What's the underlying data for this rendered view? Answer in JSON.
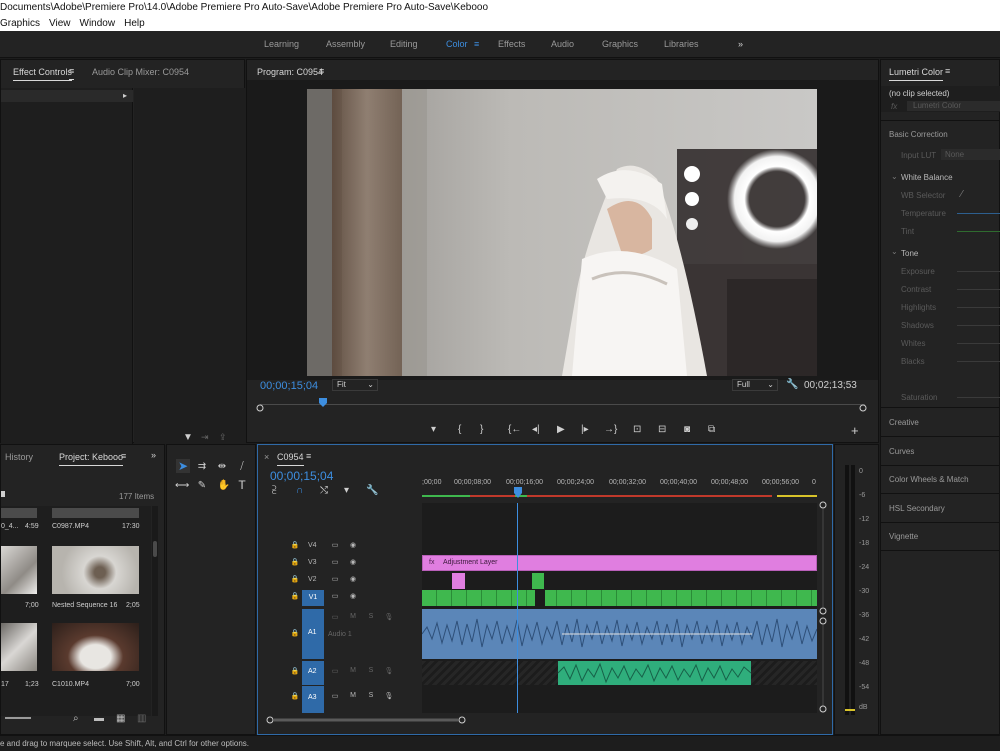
{
  "window": {
    "title": "Documents\\Adobe\\Premiere Pro\\14.0\\Adobe Premiere Pro Auto-Save\\Adobe Premiere Pro Auto-Save\\Kebooo"
  },
  "menu": [
    "Graphics",
    "View",
    "Window",
    "Help"
  ],
  "workspaces": [
    "Learning",
    "Assembly",
    "Editing",
    "Color",
    "Effects",
    "Audio",
    "Graphics",
    "Libraries"
  ],
  "workspace_active": "Color",
  "workspace_more": "»",
  "effect_panel": {
    "tab_effect_controls": "Effect Controls",
    "tab_audio_mixer": "Audio Clip Mixer: C0954"
  },
  "program": {
    "title": "Program: C0954",
    "timecode": "00;00;15;04",
    "fit": "Fit",
    "quality": "Full",
    "duration": "00;02;13;53"
  },
  "lumetri": {
    "title": "Lumetri Color",
    "clip": "(no clip selected)",
    "fx_label": "fx",
    "fx_name": "Lumetri Color",
    "basic_correction": "Basic Correction",
    "input_lut": "Input LUT",
    "lut_value": "None",
    "white_balance": "White Balance",
    "wb_selector": "WB Selector",
    "temperature": "Temperature",
    "tint": "Tint",
    "tone": "Tone",
    "exposure": "Exposure",
    "contrast": "Contrast",
    "highlights": "Highlights",
    "shadows": "Shadows",
    "whites": "Whites",
    "blacks": "Blacks",
    "saturation": "Saturation",
    "creative": "Creative",
    "curves": "Curves",
    "color_wheels": "Color Wheels & Match",
    "hsl": "HSL Secondary",
    "vignette": "Vignette"
  },
  "project": {
    "tab_history": "History",
    "tab_project": "Project: Kebooo",
    "items_count": "177 Items",
    "items": [
      {
        "name": "0_4...",
        "dur": "4:59"
      },
      {
        "name": "C0987.MP4",
        "dur": "17:30"
      },
      {
        "name": "",
        "dur": "7;00"
      },
      {
        "name": "Nested Sequence 16",
        "dur": "2;05"
      },
      {
        "name": "17",
        "dur": "1;23"
      },
      {
        "name": "C1010.MP4",
        "dur": "7;00"
      }
    ]
  },
  "timeline": {
    "sequence": "C0954",
    "timecode": "00;00;15;04",
    "ruler": [
      ";00;00",
      "00;00;08;00",
      "00;00;16;00",
      "00;00;24;00",
      "00;00;32;00",
      "00;00;40;00",
      "00;00;48;00",
      "00;00;56;00",
      "0"
    ],
    "tracks_video": [
      "V4",
      "V3",
      "V2",
      "V1"
    ],
    "tracks_audio": [
      "A1",
      "A2",
      "A3"
    ],
    "audio1_label": "Audio 1",
    "adjustment_layer": "Adjustment Layer",
    "mute": "M",
    "solo": "S"
  },
  "meter": {
    "labels": [
      "0",
      "-6",
      "-12",
      "-18",
      "-24",
      "-30",
      "-36",
      "-42",
      "-48",
      "-54",
      "dB"
    ]
  },
  "status": {
    "text": "e and drag to marquee select. Use Shift, Alt, and Ctrl for other options."
  },
  "colors": {
    "accent": "#3d8ee0",
    "adjustment": "#e07ee0",
    "video_clip": "#3fb84e",
    "audio_clip": "#5b86b8",
    "audio_green": "#2fae7c"
  }
}
